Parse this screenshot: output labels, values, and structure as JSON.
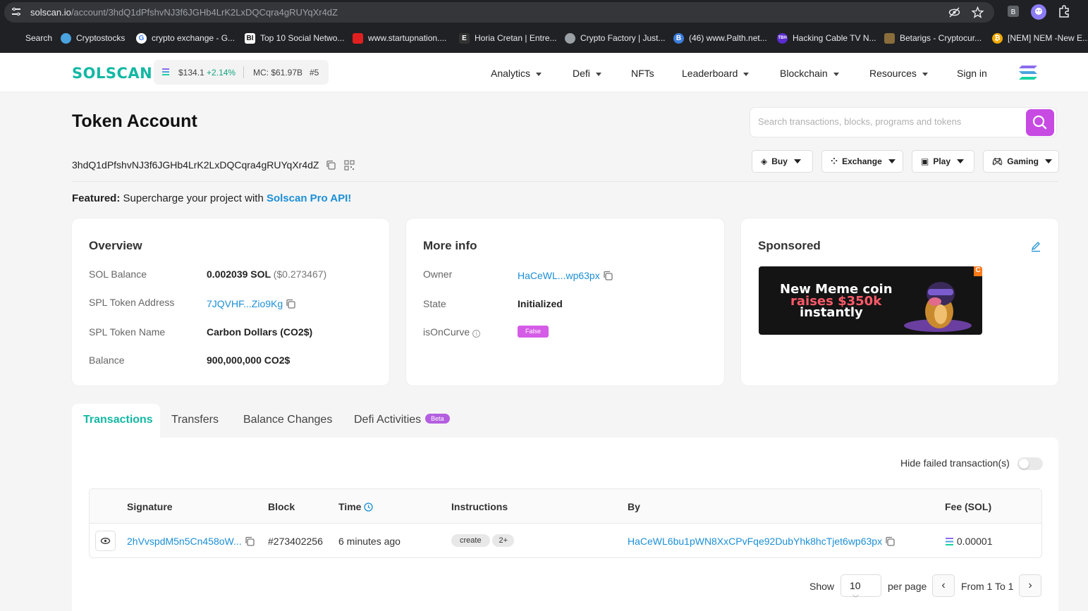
{
  "browser": {
    "url_domain": "solscan.io",
    "url_path": "/account/3hdQ1dPfshvNJ3f6JGHb4LrK2LxDQCqra4gRUYqXr4dZ",
    "bookmarks": [
      {
        "label": "Search",
        "icon": "search-icon",
        "color": "#202124"
      },
      {
        "label": "Cryptostocks",
        "icon": "cryptostocks-icon",
        "color": "#4aa3df"
      },
      {
        "label": "crypto exchange - G...",
        "icon": "google-icon",
        "color": "#ffffff"
      },
      {
        "label": "Top 10 Social Netwo...",
        "icon": "bi-icon",
        "color": "#ffffff"
      },
      {
        "label": "www.startupnation....",
        "icon": "startupnation-icon",
        "color": "#e02020"
      },
      {
        "label": "Horia Cretan | Entre...",
        "icon": "e-icon",
        "color": "#333333"
      },
      {
        "label": "Crypto Factory | Just...",
        "icon": "globe-icon",
        "color": "#9aa0a6"
      },
      {
        "label": "(46) www.Palth.net...",
        "icon": "palth-icon",
        "color": "#3b7ddd"
      },
      {
        "label": "Hacking Cable TV N...",
        "icon": "tbh-icon",
        "color": "#5b2ccf"
      },
      {
        "label": "Betarigs - Cryptocur...",
        "icon": "betarigs-icon",
        "color": "#8a6d3b"
      },
      {
        "label": "[NEM] NEM -New E...",
        "icon": "bitcoin-icon",
        "color": "#f2a900"
      }
    ]
  },
  "header": {
    "logo": "SOLSCAN",
    "price": "$134.1",
    "change": "+2.14%",
    "market_cap": "MC: $61.97B",
    "rank": "#5",
    "nav": [
      "Analytics",
      "Defi",
      "NFTs",
      "Leaderboard",
      "Blockchain",
      "Resources",
      "Sign in"
    ]
  },
  "page": {
    "title": "Token Account",
    "search_placeholder": "Search transactions, blocks, programs and tokens",
    "address": "3hdQ1dPfshvNJ3f6JGHb4LrK2LxDQCqra4gRUYqXr4dZ",
    "buttons": [
      "Buy",
      "Exchange",
      "Play",
      "Gaming"
    ],
    "featured_label": "Featured:",
    "featured_text": "Supercharge your project with",
    "featured_link": "Solscan Pro API!"
  },
  "overview": {
    "title": "Overview",
    "sol_balance_label": "SOL Balance",
    "sol_balance": "0.002039 SOL",
    "sol_balance_usd": "($0.273467)",
    "spl_address_label": "SPL Token Address",
    "spl_address": "7JQVHF...Zio9Kg",
    "spl_name_label": "SPL Token Name",
    "spl_name": "Carbon Dollars (CO2$)",
    "balance_label": "Balance",
    "balance": "900,000,000 CO2$"
  },
  "more_info": {
    "title": "More info",
    "owner_label": "Owner",
    "owner": "HaCeWL...wp63px",
    "state_label": "State",
    "state": "Initialized",
    "curve_label": "isOnCurve",
    "curve": "False"
  },
  "sponsored": {
    "title": "Sponsored",
    "ad_line1": "New Meme coin",
    "ad_line2": "raises $350k",
    "ad_line3": "instantly"
  },
  "tabs": [
    "Transactions",
    "Transfers",
    "Balance Changes",
    "Defi Activities"
  ],
  "beta_label": "Beta",
  "transactions": {
    "hide_failed_label": "Hide failed transaction(s)",
    "columns": [
      "Signature",
      "Block",
      "Time",
      "Instructions",
      "By",
      "Fee (SOL)"
    ],
    "rows": [
      {
        "signature": "2hVvspdM5n5Cn458oW...",
        "block": "#273402256",
        "time": "6 minutes ago",
        "instruction": "create",
        "more": "2+",
        "by": "HaCeWL6bu1pWN8XxCPvFqe92DubYhk8hcTjet6wp63px",
        "fee": "0.00001"
      }
    ],
    "show_label": "Show",
    "per_page_value": "10",
    "per_page_label": "per page",
    "range_label": "From 1 To 1"
  },
  "colors": {
    "accent": "#13b8a3",
    "link": "#1b8fd6",
    "search_button": "#c74ae3"
  }
}
